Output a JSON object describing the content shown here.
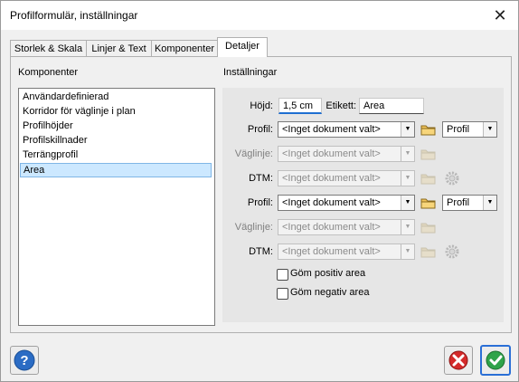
{
  "window": {
    "title": "Profilformulär, inställningar"
  },
  "tabs": [
    {
      "label": "Storlek & Skala"
    },
    {
      "label": "Linjer & Text"
    },
    {
      "label": "Komponenter"
    },
    {
      "label": "Detaljer"
    }
  ],
  "components": {
    "title": "Komponenter",
    "items": [
      "Användardefinierad",
      "Korridor för väglinje i plan",
      "Profilhöjder",
      "Profilskillnader",
      "Terrängprofil",
      "Area"
    ],
    "selected": "Area"
  },
  "settings": {
    "title": "Inställningar",
    "hojd_label": "Höjd:",
    "hojd_value": "1,5 cm",
    "etikett_label": "Etikett:",
    "etikett_value": "Area",
    "profil_label": "Profil:",
    "vaglinje_label": "Väglinje:",
    "dtm_label": "DTM:",
    "no_doc": "<Inget dokument valt>",
    "profil_type": "Profil",
    "hide_positive": "Göm positiv area",
    "hide_negative": "Göm negativ area"
  },
  "colors": {
    "accent": "#1f6fd1",
    "selection": "#cce8ff"
  },
  "icons": {
    "folder": "folder-icon",
    "gear": "gear-icon",
    "help": "help-icon",
    "cancel": "cancel-icon",
    "ok": "ok-icon"
  }
}
